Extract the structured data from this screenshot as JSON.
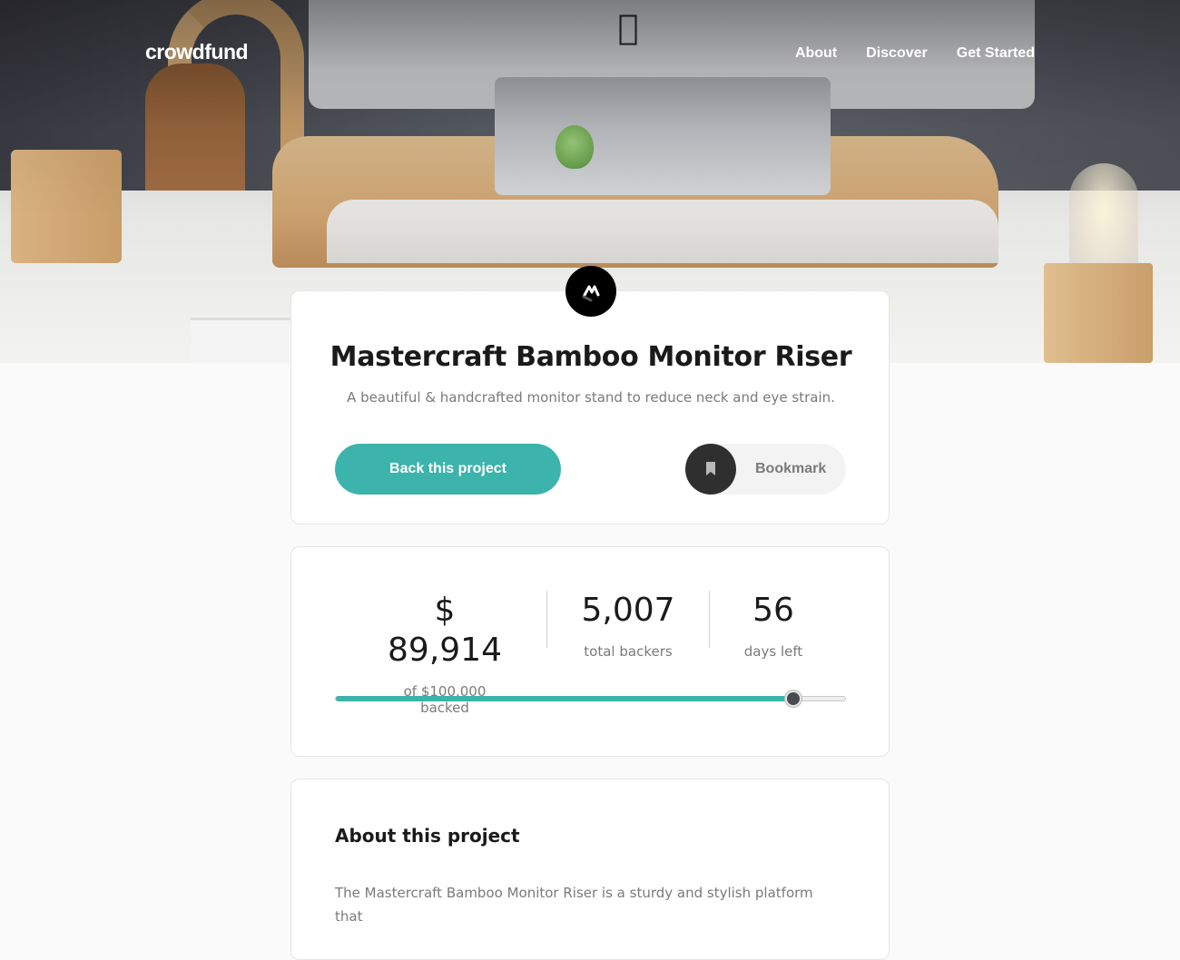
{
  "brand": {
    "logo_text": "crowdfund"
  },
  "nav": {
    "items": [
      {
        "label": "About"
      },
      {
        "label": "Discover"
      },
      {
        "label": "Get Started"
      }
    ]
  },
  "project": {
    "title": "Mastercraft Bamboo Monitor Riser",
    "description": "A beautiful & handcrafted monitor stand to reduce neck and eye strain.",
    "back_button_label": "Back this project",
    "bookmark_label": "Bookmark",
    "logo_icon": "mastercraft-logo-icon"
  },
  "stats": {
    "backed": {
      "value": "$ 89,914",
      "label": "of $100.000 backed"
    },
    "backers": {
      "value": "5,007",
      "label": "total backers"
    },
    "days_left": {
      "value": "56",
      "label": "days left"
    },
    "progress_fraction": 0.89914
  },
  "about": {
    "title": "About this project",
    "text": "The Mastercraft Bamboo Monitor Riser is a sturdy and stylish platform that"
  },
  "colors": {
    "accent": "#3cb3ab",
    "dark": "#2f2f2f",
    "text_muted": "#7a7a7a"
  }
}
